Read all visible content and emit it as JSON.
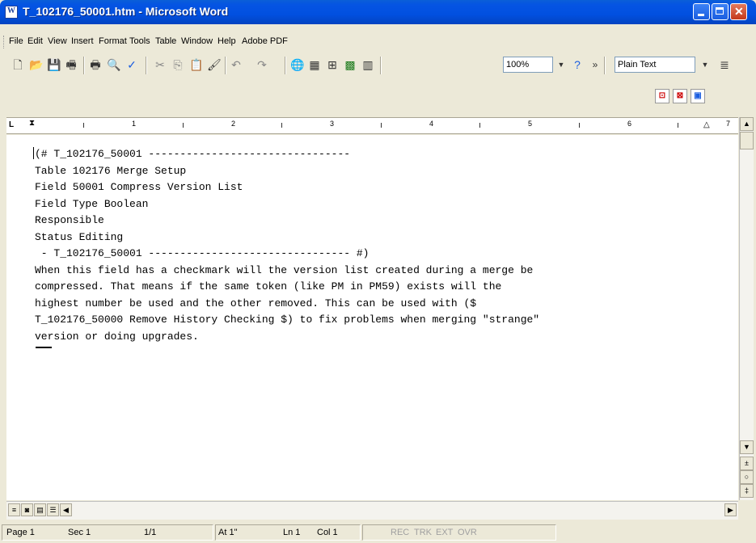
{
  "window": {
    "title": "T_102176_50001.htm - Microsoft Word"
  },
  "menu": [
    "File",
    "Edit",
    "View",
    "Insert",
    "Format",
    "Tools",
    "Table",
    "Window",
    "Help",
    "Adobe PDF"
  ],
  "toolbar": {
    "zoom": "100%",
    "style": "Plain Text",
    "icons": [
      "new-icon",
      "open-icon",
      "save-icon",
      "permission-icon",
      "print-icon",
      "print-preview-icon",
      "spelling-icon",
      "cut-icon",
      "copy-icon",
      "paste-icon",
      "format-painter-icon",
      "undo-icon",
      "redo-icon",
      "hyperlink-icon",
      "tables-borders-icon",
      "insert-table-icon",
      "insert-excel-icon",
      "columns-icon",
      "help-icon",
      "more-icon",
      "align-icon"
    ],
    "pdf_icons": [
      "convert-pdf-icon",
      "convert-pdf-email-icon",
      "pdf-review-icon"
    ]
  },
  "ruler": {
    "labels": [
      "1",
      "2",
      "3",
      "4",
      "5",
      "6",
      "7"
    ]
  },
  "document": {
    "lines": [
      "(# T_102176_50001 --------------------------------",
      "Table 102176 Merge Setup",
      "Field 50001 Compress Version List",
      "Field Type Boolean",
      "Responsible",
      "Status Editing",
      " - T_102176_50001 -------------------------------- #)",
      "When this field has a checkmark will the version list created during a merge be",
      "compressed. That means if the same token (like PM in PM59) exists will the",
      "highest number be used and the other removed. This can be used with ($",
      "T_102176_50000 Remove History Checking $) to fix problems when merging \"strange\"",
      "version or doing upgrades."
    ]
  },
  "status": {
    "page": "Page 1",
    "sec": "Sec 1",
    "pages": "1/1",
    "at": "At 1\"",
    "ln": "Ln 1",
    "col": "Col 1",
    "rec": "REC",
    "trk": "TRK",
    "ext": "EXT",
    "ovr": "OVR"
  }
}
